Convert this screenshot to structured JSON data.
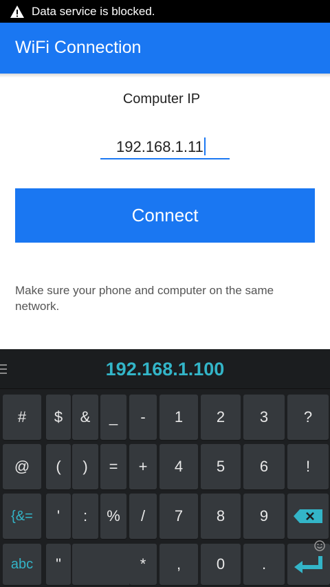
{
  "status_bar": {
    "message": "Data service is blocked.",
    "icon": "warning-icon"
  },
  "app_bar": {
    "title": "WiFi Connection",
    "color": "#1a77f2"
  },
  "form": {
    "label": "Computer IP",
    "ip_value": "192.168.1.11",
    "connect_label": "Connect",
    "hint": "Make sure your phone and computer on the same network."
  },
  "keyboard": {
    "suggestion": "192.168.1.100",
    "rows": [
      [
        "#",
        "$",
        "&",
        "_",
        "-",
        "1",
        "2",
        "3",
        "?"
      ],
      [
        "@",
        "(",
        ")",
        "=",
        "+",
        "4",
        "5",
        "6",
        "!"
      ],
      [
        "{&=",
        "'",
        ":",
        "%",
        "/",
        "7",
        "8",
        "9",
        "backspace"
      ],
      [
        "abc",
        "\"",
        "",
        "*",
        ",",
        "0",
        ".",
        "enter"
      ]
    ],
    "accent_color": "#33b5c8"
  }
}
